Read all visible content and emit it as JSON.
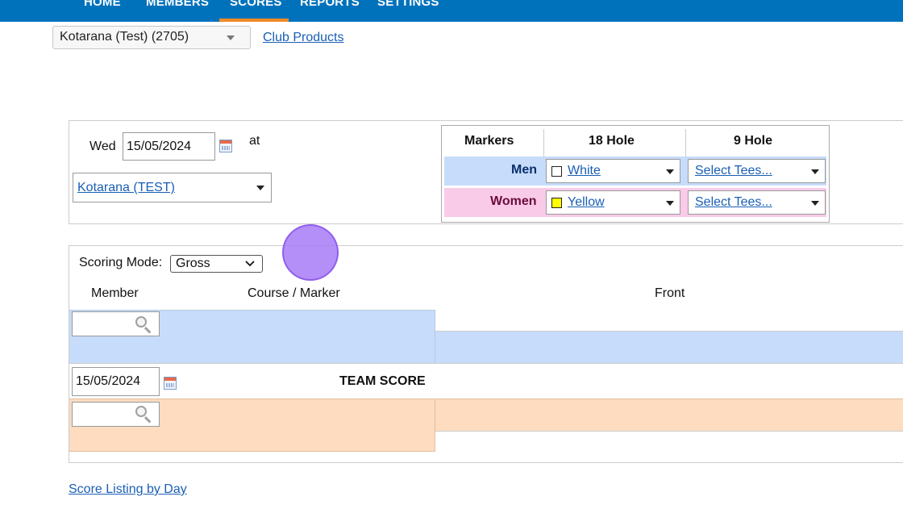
{
  "nav": {
    "items": [
      "HOME",
      "MEMBERS",
      "SCORES",
      "REPORTS",
      "SETTINGS"
    ],
    "active": "SCORES",
    "bar_color": "#0072bc",
    "active_underline_color": "#f08a24"
  },
  "club_selector": {
    "value": "Kotarana (Test) (2705)"
  },
  "club_products_link": "Club Products",
  "date_panel": {
    "day": "Wed",
    "date": "15/05/2024",
    "at": "at",
    "course": "Kotarana (TEST)"
  },
  "markers_table": {
    "headers": [
      "Markers",
      "18 Hole",
      "9 Hole"
    ],
    "rows": [
      {
        "label": "Men",
        "tee18": "White",
        "tee9": "Select Tees...",
        "swatch": "#ffffff",
        "bg": "#c6dcfa",
        "label_color": "#0b2e6b"
      },
      {
        "label": "Women",
        "tee18": "Yellow",
        "tee9": "Select Tees...",
        "swatch": "#ffff00",
        "bg": "#f9cbe8",
        "label_color": "#6b0b3e"
      }
    ]
  },
  "scoring": {
    "mode_label": "Scoring Mode:",
    "mode_value": "Gross",
    "columns": [
      "Member",
      "Course / Marker",
      "Front"
    ],
    "team_date": "15/05/2024",
    "team_score_label": "TEAM SCORE",
    "blue_row_color": "#c6dcfa",
    "orange_row_color": "#fddcc0"
  },
  "footer_link": "Score Listing by Day"
}
